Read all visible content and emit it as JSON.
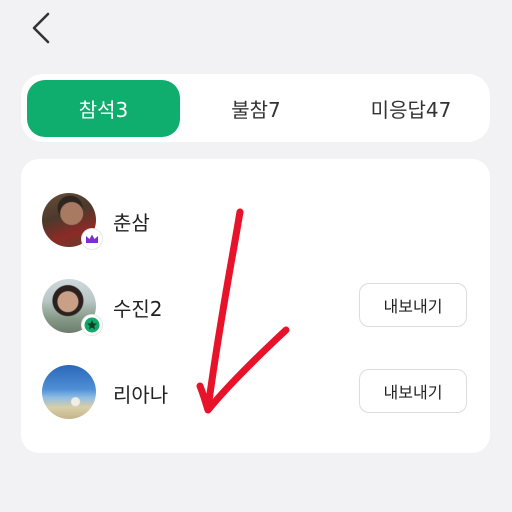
{
  "icons": {
    "back": "chevron-left-icon",
    "crown": "crown-icon",
    "star": "star-icon",
    "annotation": "red-arrow-annotation"
  },
  "colors": {
    "accent": "#0fad6e",
    "background": "#f2f2f4",
    "crown": "#7b2fd0",
    "star": "#12a869",
    "annotation": "#e8132a"
  },
  "tabs": [
    {
      "label": "참석3",
      "active": true
    },
    {
      "label": "불참7",
      "active": false
    },
    {
      "label": "미응답47",
      "active": false
    }
  ],
  "members": [
    {
      "name": "춘삼",
      "badge": "crown",
      "action": ""
    },
    {
      "name": "수진2",
      "badge": "star",
      "action": "내보내기"
    },
    {
      "name": "리아나",
      "badge": "",
      "action": "내보내기"
    }
  ]
}
